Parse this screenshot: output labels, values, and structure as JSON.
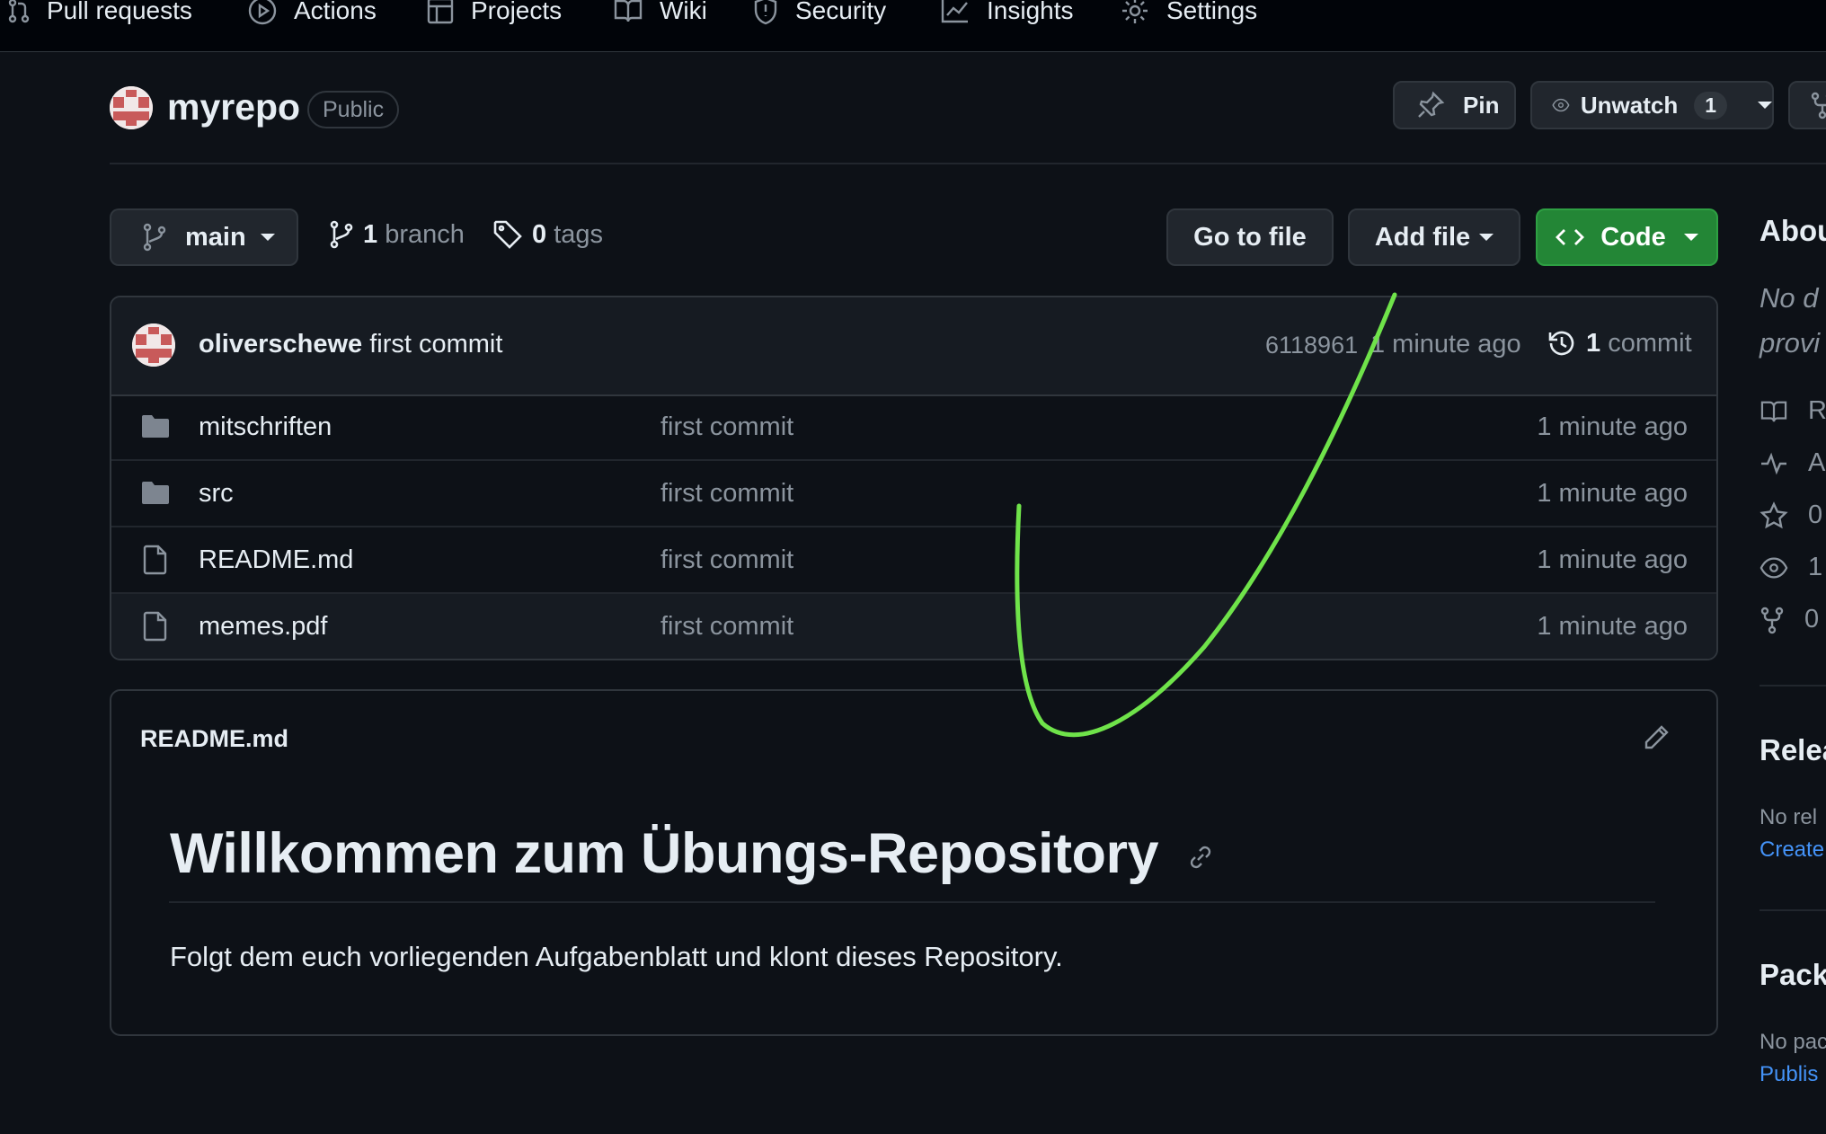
{
  "nav": {
    "items": [
      {
        "label": "Pull requests",
        "icon": "pull-request-icon"
      },
      {
        "label": "Actions",
        "icon": "play-icon"
      },
      {
        "label": "Projects",
        "icon": "table-icon"
      },
      {
        "label": "Wiki",
        "icon": "book-icon"
      },
      {
        "label": "Security",
        "icon": "shield-icon"
      },
      {
        "label": "Insights",
        "icon": "graph-icon"
      },
      {
        "label": "Settings",
        "icon": "gear-icon"
      }
    ]
  },
  "repo": {
    "name": "myrepo",
    "visibility": "Public",
    "pin_label": "Pin",
    "unwatch_label": "Unwatch",
    "watch_count": "1"
  },
  "toolbar": {
    "branch": "main",
    "branch_count": "1",
    "branch_word": "branch",
    "tag_count": "0",
    "tag_word": "tags",
    "go_to_file": "Go to file",
    "add_file": "Add file",
    "code": "Code"
  },
  "latest_commit": {
    "author": "oliverschewe",
    "message": "first commit",
    "sha": "6118961",
    "age": "1 minute ago",
    "commit_count": "1",
    "commit_word": "commit"
  },
  "files": [
    {
      "name": "mitschriften",
      "type": "folder",
      "message": "first commit",
      "age": "1 minute ago"
    },
    {
      "name": "src",
      "type": "folder",
      "message": "first commit",
      "age": "1 minute ago"
    },
    {
      "name": "README.md",
      "type": "file",
      "message": "first commit",
      "age": "1 minute ago"
    },
    {
      "name": "memes.pdf",
      "type": "file",
      "message": "first commit",
      "age": "1 minute ago"
    }
  ],
  "readme": {
    "filename": "README.md",
    "heading": "Willkommen zum Übungs-Repository",
    "body": "Folgt dem euch vorliegenden Aufgabenblatt und klont dieses Repository."
  },
  "sidebar": {
    "about_heading": "Abou",
    "desc_line1": "No d",
    "desc_line2": "provi",
    "stats": [
      {
        "icon": "book-icon",
        "text": "R"
      },
      {
        "icon": "pulse-icon",
        "text": "A"
      },
      {
        "icon": "star-icon",
        "text": "0"
      },
      {
        "icon": "eye-icon",
        "text": "1"
      },
      {
        "icon": "fork-icon",
        "text": "0"
      }
    ],
    "releases_heading": "Relea",
    "releases_text": "No rel",
    "releases_link": "Create",
    "packages_heading": "Pack",
    "packages_text": "No pac",
    "packages_link": "Publis"
  },
  "colors": {
    "background": "#0d1117",
    "accent_green": "#238636",
    "link_blue": "#4493f8",
    "annotation_stroke": "#6fe34a"
  }
}
